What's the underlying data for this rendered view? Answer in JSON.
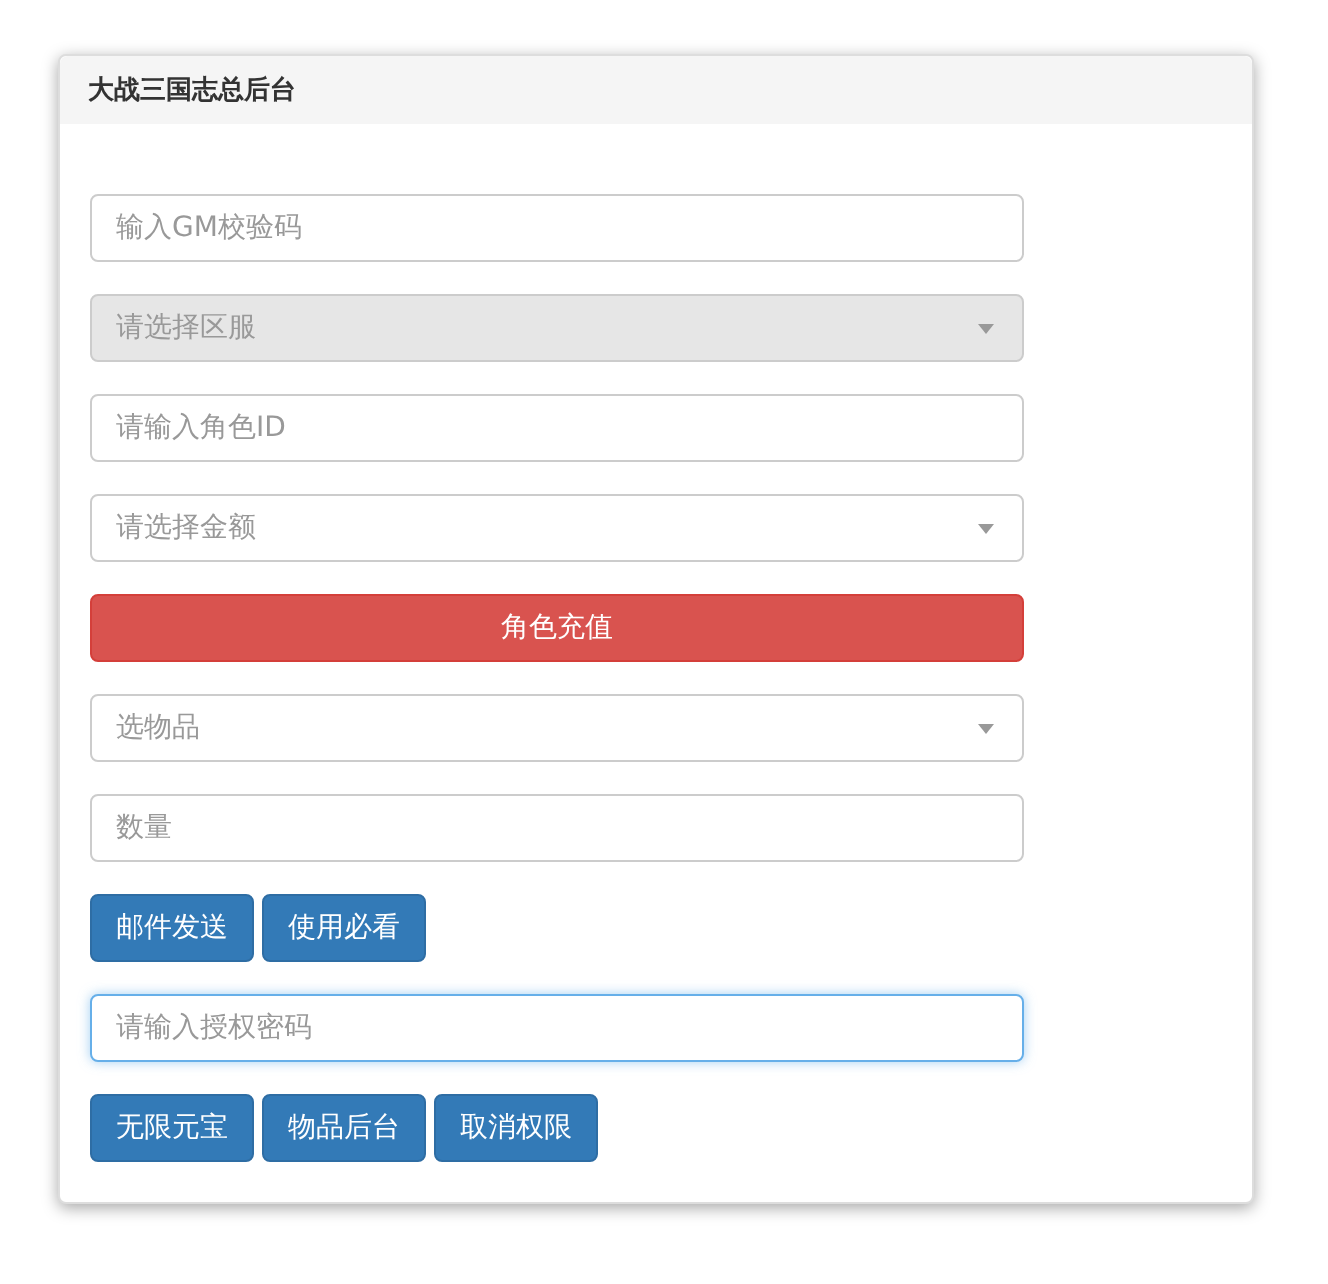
{
  "panel": {
    "title": "大战三国志总后台"
  },
  "items": [
    {
      "kind": "input",
      "placeholder": "输入GM校验码",
      "focused": false
    },
    {
      "kind": "select",
      "placeholder": "请选择区服",
      "disabled": true
    },
    {
      "kind": "input",
      "placeholder": "请输入角色ID",
      "focused": false
    },
    {
      "kind": "select",
      "placeholder": "请选择金额",
      "disabled": false
    },
    {
      "kind": "danger",
      "label": "角色充值"
    },
    {
      "kind": "select",
      "placeholder": "选物品",
      "disabled": false
    },
    {
      "kind": "input",
      "placeholder": "数量",
      "focused": false
    },
    {
      "kind": "buttons",
      "buttons": [
        "邮件发送",
        "使用必看"
      ]
    },
    {
      "kind": "input",
      "placeholder": "请输入授权密码",
      "focused": true
    },
    {
      "kind": "buttons",
      "buttons": [
        "无限元宝",
        "物品后台",
        "取消权限"
      ]
    }
  ]
}
